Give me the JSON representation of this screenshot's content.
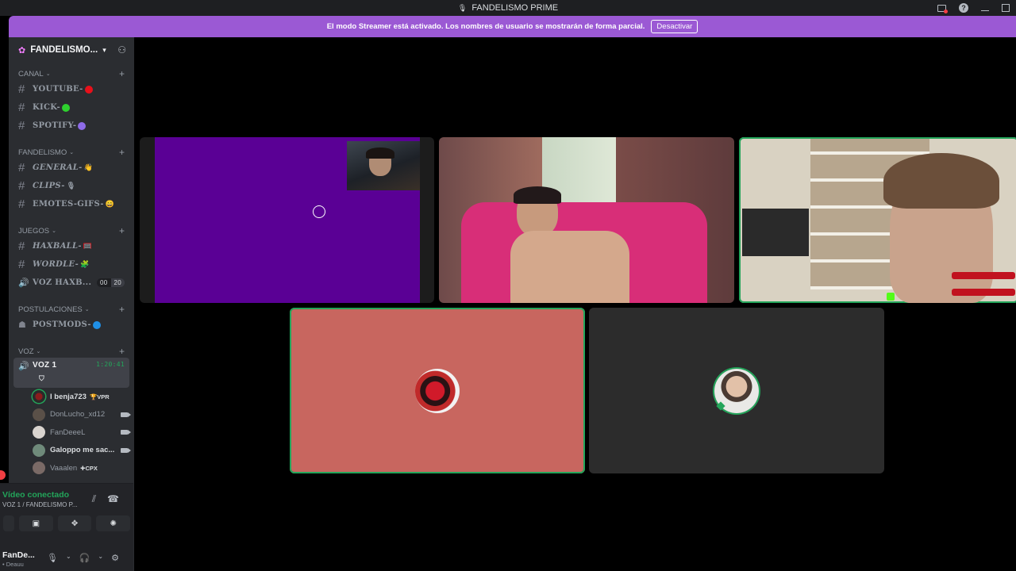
{
  "window": {
    "title": "FANDELISMO PRIME"
  },
  "streamer_banner": {
    "text": "El modo Streamer está activado. Los nombres de usuario se mostrarán de forma parcial.",
    "button": "Desactivar"
  },
  "server": {
    "name": "FANDELISMO..."
  },
  "categories": [
    {
      "name": "CANAL",
      "channels": [
        {
          "label": "YOUTUBE-",
          "dot_color": "#e8101a"
        },
        {
          "label": "KICK-",
          "dot_color": "#2ed12e"
        },
        {
          "label": "SPOTIFY-",
          "dot_color": "#8e6be8"
        }
      ]
    },
    {
      "name": "FANDELISMO",
      "channels": [
        {
          "label": "GENERAL-",
          "emoji": "👋"
        },
        {
          "label": "CLIPS-",
          "emoji": "🎙"
        },
        {
          "label": "EMOTES-GIFS-",
          "emoji": "😄"
        }
      ]
    },
    {
      "name": "JUEGOS",
      "channels": [
        {
          "label": "HAXBALL-",
          "emoji": "🥅"
        },
        {
          "label": "WORDLE-",
          "emoji": "🧩"
        },
        {
          "label": "VOZ HAXB...",
          "count_left": "00",
          "count_right": "20"
        }
      ]
    },
    {
      "name": "POSTULACIONES",
      "channels": [
        {
          "label": "POSTMODS-",
          "dot_color": "#1f8fe6"
        }
      ]
    },
    {
      "name": "VOZ",
      "channels": [
        {
          "label": "VOZ 1",
          "timer": "1:20:41"
        }
      ]
    }
  ],
  "voice_users": [
    {
      "name": "I benja723",
      "badge": "🏆VPR",
      "bold": true,
      "speaking": true,
      "camera": false
    },
    {
      "name": "DonLucho_xd12",
      "badge": "",
      "bold": false,
      "speaking": false,
      "camera": true
    },
    {
      "name": "FanDeeeL",
      "badge": "",
      "bold": false,
      "speaking": false,
      "camera": true
    },
    {
      "name": "Galoppo me sac...",
      "badge": "",
      "bold": true,
      "speaking": false,
      "camera": true
    },
    {
      "name": "Vaaalen",
      "badge": "✚CPX",
      "bold": false,
      "speaking": false,
      "camera": false
    }
  ],
  "voice_panel": {
    "status": "Vídeo conectado",
    "sub": "VOZ 1 / FANDELISMO P..."
  },
  "user_panel": {
    "name": "FanDe...",
    "status": "• Deauu"
  },
  "colors": {
    "accent_green": "#23a55a",
    "streamer_purple": "#9b59d4",
    "tile_purple": "#5a0095",
    "tile_salmon": "#c8665f",
    "tile_dark": "#2c2c2c"
  }
}
